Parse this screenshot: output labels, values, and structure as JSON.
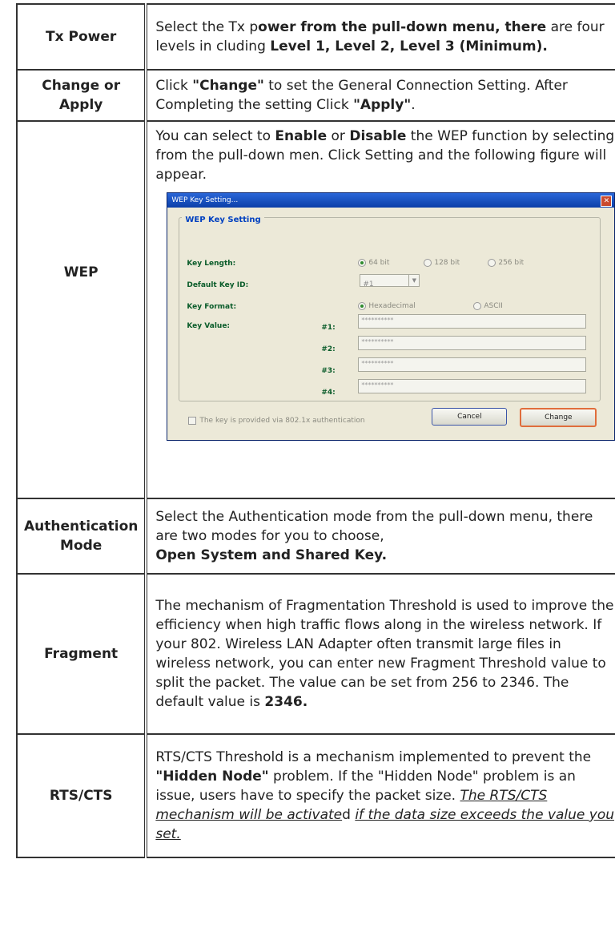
{
  "rows": {
    "tx_power": {
      "label": "Tx Power",
      "t1": "Select the Tx p",
      "b1": "ower from the pull-down menu, there",
      "t2": " are four levels in cluding ",
      "b2": "Level 1, Level 2, Level 3 (Minimum)."
    },
    "change_apply": {
      "label": "Change or Apply",
      "t1": "Click ",
      "b1": "\"Change\"",
      "t2": " to set the General Connection Setting. After Completing the setting Click ",
      "b2": "\"Apply\"",
      "t3": "."
    },
    "wep": {
      "label": "WEP",
      "t1": "You can select to ",
      "b1": "Enable",
      "t2": " or ",
      "b2": "Disable",
      "t3": " the WEP function by selecting from the pull-down men. Click Setting and the following figure will appear."
    },
    "auth": {
      "label": "Authentication Mode",
      "t1": "Select the Authentication mode from the pull-down menu, there are two modes for you to choose,",
      "b1": "Open System and Shared Key."
    },
    "fragment": {
      "label": "Fragment",
      "t1": "The mechanism of Fragmentation Threshold is used to improve the efficiency when high traffic flows along in the wireless network. If your 802. Wireless LAN Adapter often transmit large files in wireless network, you can enter new Fragment Threshold value to split the packet. The value can be set from 256 to 2346. The default value is ",
      "b1": "2346."
    },
    "rts": {
      "label": "RTS/CTS",
      "t1": "RTS/CTS Threshold is a mechanism implemented to prevent the ",
      "b1": "\"Hidden Node\"",
      "t2": " problem. If the \"Hidden Node\" problem is an issue, users have to specify the packet size. ",
      "u1": "The RTS/CTS mechanism will be activate",
      "t3": "d ",
      "u2": "if the data size exceeds the value you set."
    }
  },
  "dialog": {
    "title": "WEP Key Setting...",
    "close": "✕",
    "group_title": "WEP Key Setting",
    "key_length_label": "Key Length:",
    "key_length_options": [
      "64 bit",
      "128 bit",
      "256 bit"
    ],
    "default_key_label": "Default Key ID:",
    "default_key_value": "#1",
    "key_format_label": "Key Format:",
    "key_format_options": [
      "Hexadecimal",
      "ASCII"
    ],
    "key_value_label": "Key Value:",
    "key_ids": [
      "#1:",
      "#2:",
      "#3:",
      "#4:"
    ],
    "key_values": [
      "**********",
      "**********",
      "**********",
      "**********"
    ],
    "checkbox_label": "The key is provided via 802.1x authentication",
    "cancel_label": "Cancel",
    "change_label": "Change"
  }
}
